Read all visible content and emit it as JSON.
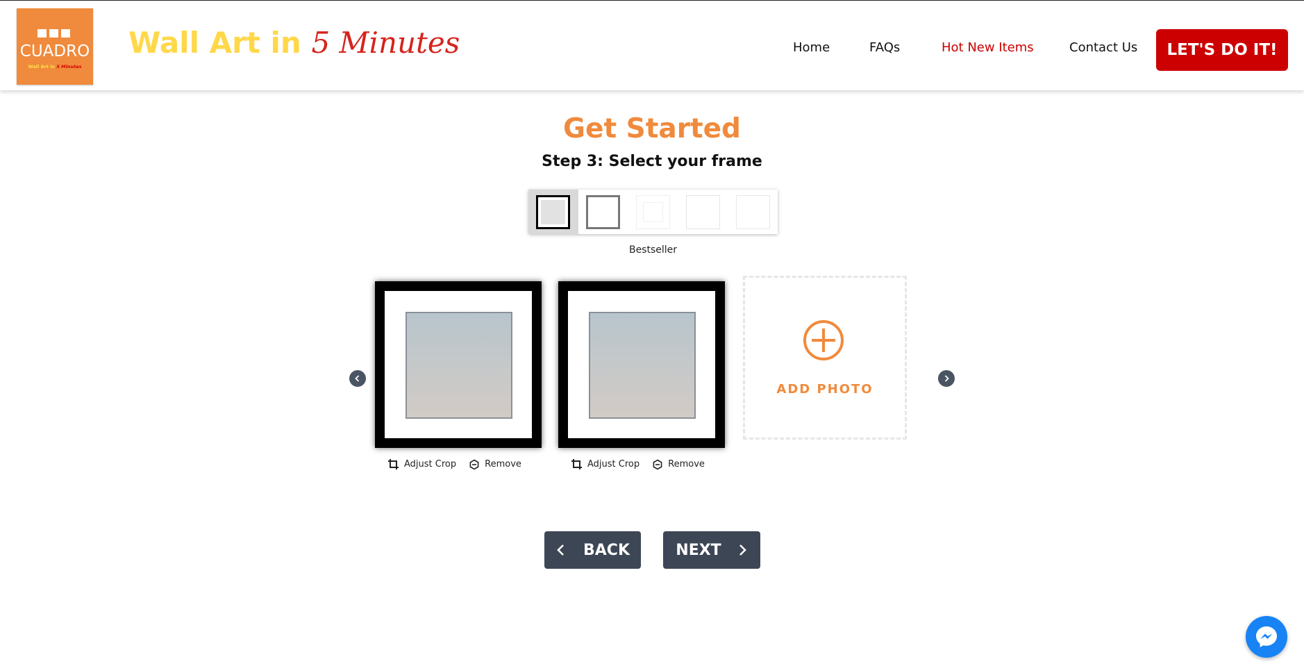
{
  "header": {
    "logo": {
      "word": "CUADRO",
      "tagline_prefix": "Wall Art in ",
      "tagline_accent": "5 Minutes"
    },
    "tagline": {
      "prefix": "Wall Art in ",
      "accent": "5 Minutes"
    },
    "nav": [
      {
        "label": "Home"
      },
      {
        "label": "FAQs"
      },
      {
        "label": "Hot New Items",
        "active": true
      },
      {
        "label": "Contact Us"
      }
    ],
    "cta_label": "LET'S DO IT!"
  },
  "main": {
    "title": "Get Started",
    "step": "Step 3: Select your frame",
    "frames": {
      "selected_index": 0,
      "caption": "Bestseller",
      "options": [
        {
          "style": "black-bestseller"
        },
        {
          "style": "gray"
        },
        {
          "style": "white-light"
        },
        {
          "style": "white"
        },
        {
          "style": "white-plain"
        }
      ]
    },
    "photos": [
      {
        "adjust_label": "Adjust Crop",
        "remove_label": "Remove"
      },
      {
        "adjust_label": "Adjust Crop",
        "remove_label": "Remove"
      }
    ],
    "add_photo_label": "ADD PHOTO",
    "back_label": "BACK",
    "next_label": "NEXT"
  },
  "icons": [
    "crop-icon",
    "remove-icon",
    "plus-circle-icon",
    "chevron-left-icon",
    "chevron-right-icon",
    "messenger-icon"
  ],
  "colors": {
    "brand_orange": "#f08a3c",
    "tagline_yellow": "#ffd84a",
    "accent_red": "#cc0000",
    "button_slate": "#3d4654",
    "messenger_blue": "#1783f5"
  }
}
